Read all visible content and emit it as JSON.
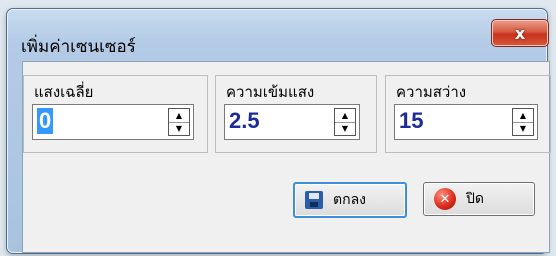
{
  "window": {
    "title": "เพิ่มค่าเซนเซอร์",
    "close_label": "x"
  },
  "fields": [
    {
      "label": "แสงเฉลี่ย",
      "value": "0"
    },
    {
      "label": "ความเข้มแสง",
      "value": "2.5"
    },
    {
      "label": "ความสว่าง",
      "value": "15"
    }
  ],
  "buttons": {
    "ok_label": "ตกลง",
    "close_label": "ปิด"
  },
  "icons": {
    "ok": "disk-icon",
    "close": "x-icon"
  }
}
